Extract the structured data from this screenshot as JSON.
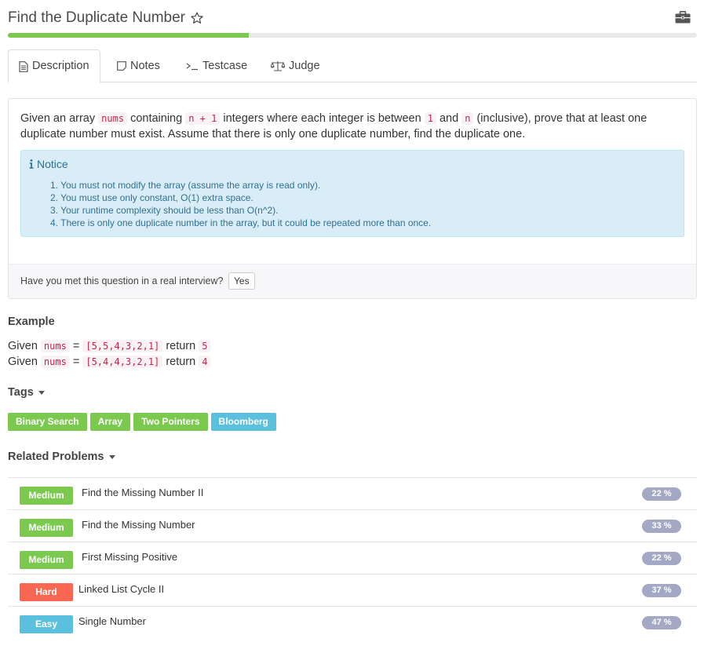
{
  "header": {
    "title": "Find the Duplicate Number",
    "star_icon": "star-outline-icon",
    "briefcase_icon": "briefcase-icon"
  },
  "progress": {
    "value_percent": 35,
    "color": "#7cc94f"
  },
  "tabs": [
    {
      "label": "Description",
      "icon": "document-icon",
      "active": true
    },
    {
      "label": "Notes",
      "icon": "note-icon",
      "active": false
    },
    {
      "label": "Testcase",
      "icon": "terminal-icon",
      "active": false
    },
    {
      "label": "Judge",
      "icon": "scale-icon",
      "active": false
    }
  ],
  "description": {
    "t1": "Given an array ",
    "c1": "nums",
    "t2": " containing ",
    "c2": "n + 1",
    "t3": " integers where each integer is between ",
    "c3": "1",
    "t4": " and ",
    "c4": "n",
    "t5": " (inclusive), prove that at least one duplicate number must exist. Assume that there is only one duplicate number, find the duplicate one."
  },
  "notice": {
    "title": "Notice",
    "items": [
      "1. You must not modify the array (assume the array is read only).",
      "2. You must use only constant, O(1) extra space.",
      "3. Your runtime complexity should be less than O(n^2).",
      "4. There is only one duplicate number in the array, but it could be repeated more than once."
    ],
    "bg_color": "#d9edf7"
  },
  "interview": {
    "question": "Have you met this question in a real interview?",
    "yes_label": "Yes"
  },
  "example": {
    "title": "Example",
    "lines": [
      {
        "given": "Given",
        "var": "nums",
        "eq": "=",
        "array": "[5,5,4,3,2,1]",
        "ret": "return",
        "value": "5"
      },
      {
        "given": "Given",
        "var": "nums",
        "eq": "=",
        "array": "[5,4,4,3,2,1]",
        "ret": "return",
        "value": "4"
      }
    ]
  },
  "tags": {
    "title": "Tags",
    "items": [
      {
        "label": "Binary Search",
        "color": "#7cc94f"
      },
      {
        "label": "Array",
        "color": "#7cc94f"
      },
      {
        "label": "Two Pointers",
        "color": "#7cc94f"
      },
      {
        "label": "Bloomberg",
        "color": "#5bc0de"
      }
    ]
  },
  "related": {
    "title": "Related Problems",
    "items": [
      {
        "difficulty": "Medium",
        "color": "#7cc94f",
        "name": "Find the Missing Number II",
        "percent": "22 %"
      },
      {
        "difficulty": "Medium",
        "color": "#7cc94f",
        "name": "Find the Missing Number",
        "percent": "33 %"
      },
      {
        "difficulty": "Medium",
        "color": "#7cc94f",
        "name": "First Missing Positive",
        "percent": "22 %"
      },
      {
        "difficulty": "Hard",
        "color": "#f96753",
        "name": "Linked List Cycle II",
        "percent": "37 %"
      },
      {
        "difficulty": "Easy",
        "color": "#5bc0de",
        "name": "Single Number",
        "percent": "47 %"
      }
    ]
  }
}
